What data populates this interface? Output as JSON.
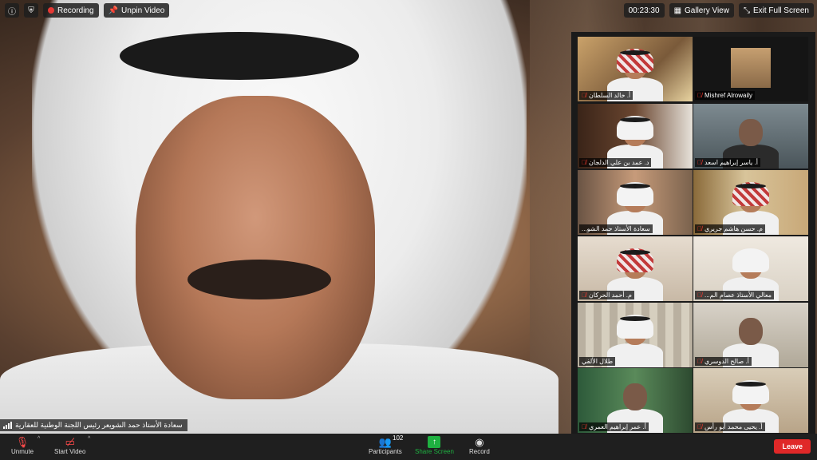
{
  "topbar": {
    "recording_label": "Recording",
    "unpin_label": "Unpin Video",
    "timer": "00:23:30",
    "gallery_view_label": "Gallery View",
    "exit_fullscreen_label": "Exit Full Screen"
  },
  "main_speaker": {
    "name": "سعادة الأستاذ حمد الشويعر رئيس اللجنة الوطنية للعقارية"
  },
  "gallery": [
    {
      "name": "أ. خالد السلطان",
      "muted": true
    },
    {
      "name": "Mishref Alrowaily",
      "muted": true
    },
    {
      "name": "د. عمد بن علي الدلجان",
      "muted": true
    },
    {
      "name": "أ. ياسر إبراهيم اسعد",
      "muted": true
    },
    {
      "name": "سعادة الأستاذ حمد الشو...",
      "muted": false,
      "active": true
    },
    {
      "name": "م. حسن هاشم جريري",
      "muted": true
    },
    {
      "name": "م. أحمد الحركان",
      "muted": true
    },
    {
      "name": "معالي الأستاذ عصام الم...",
      "muted": true
    },
    {
      "name": "طلال الألفي",
      "muted": false
    },
    {
      "name": "أ. صالح الدوسري",
      "muted": true
    },
    {
      "name": "أ. عمر إبراهيم العمري",
      "muted": true
    },
    {
      "name": "أ. يحيى محمد أبو رأس",
      "muted": true
    }
  ],
  "toolbar": {
    "unmute_label": "Unmute",
    "start_video_label": "Start Video",
    "participants_label": "Participants",
    "participants_count": "102",
    "share_screen_label": "Share Screen",
    "record_label": "Record",
    "leave_label": "Leave"
  },
  "colors": {
    "active_outline": "#c9d35a",
    "leave": "#e02828",
    "share": "#1fb141",
    "recording_dot": "#e53935"
  }
}
